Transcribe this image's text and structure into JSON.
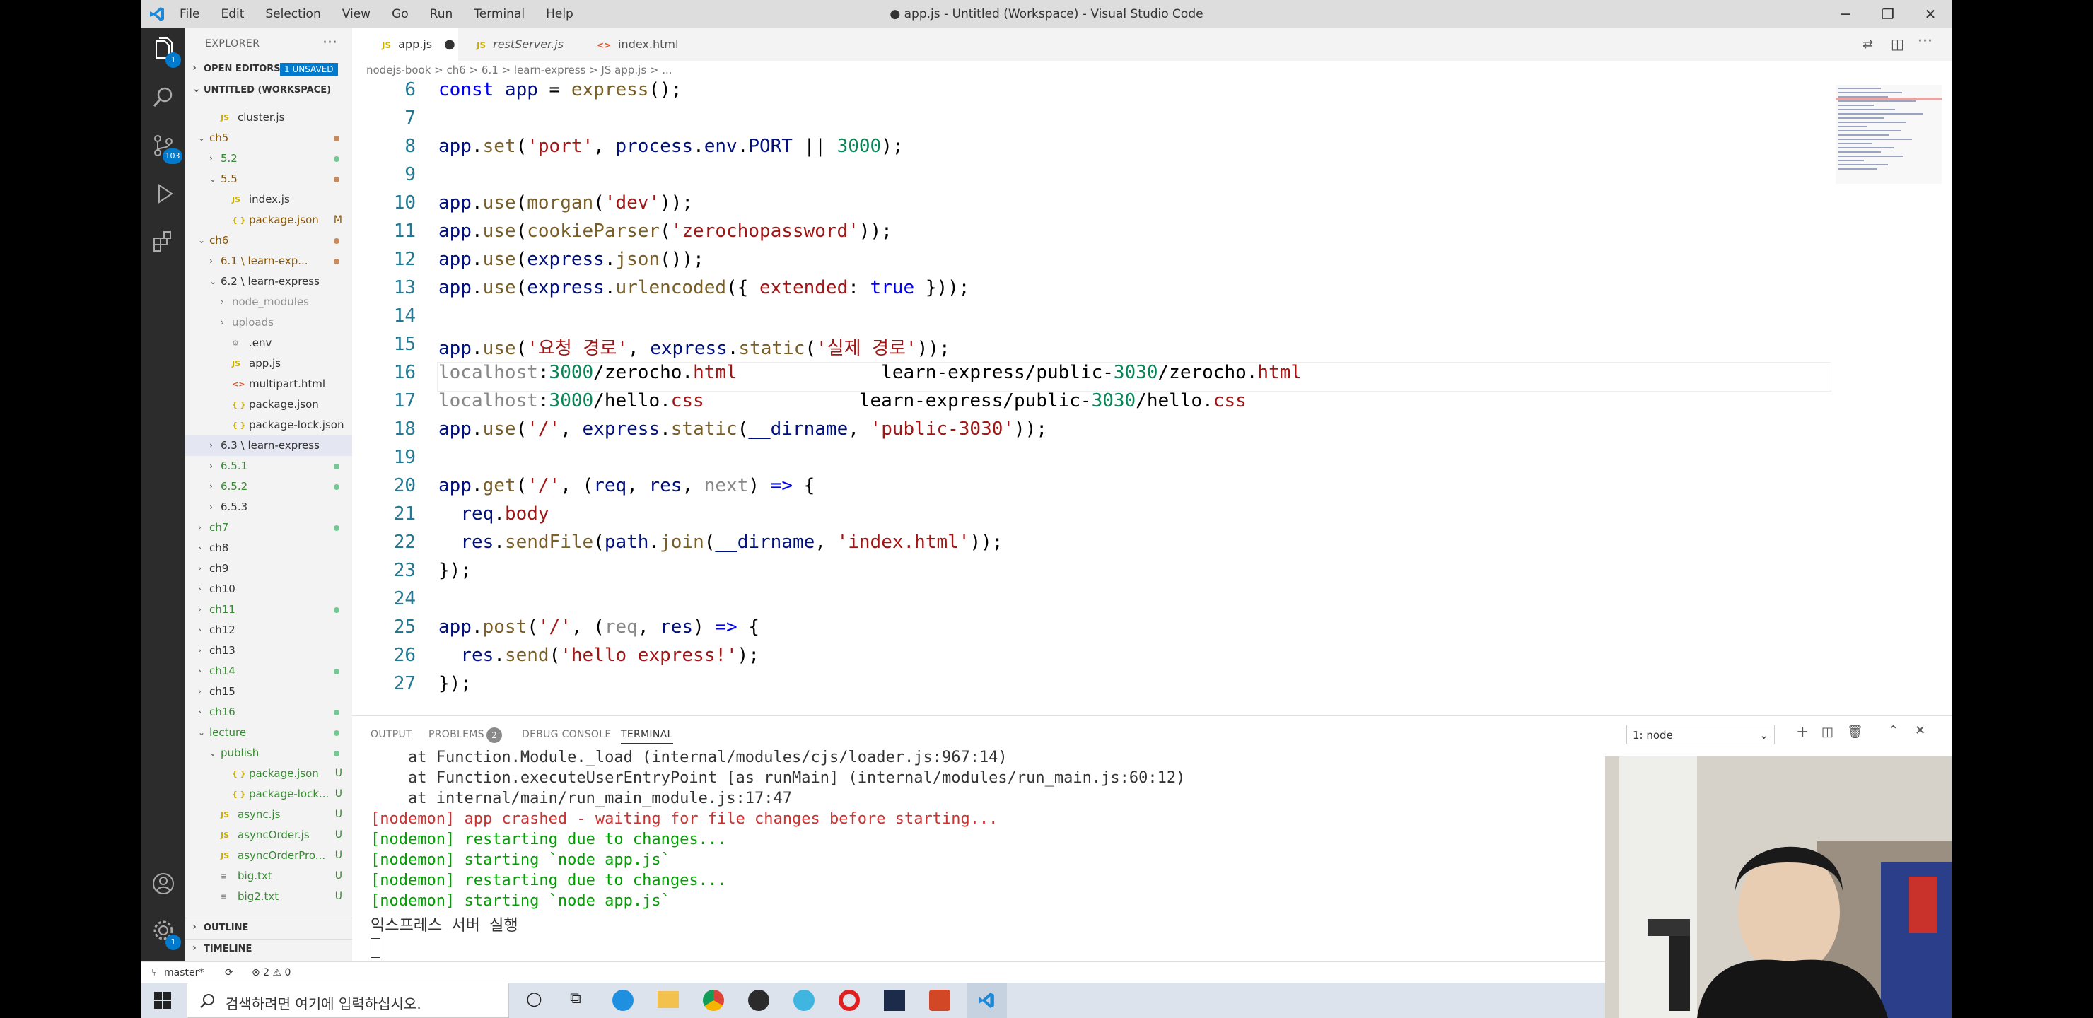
{
  "window": {
    "title": "● app.js - Untitled (Workspace) - Visual Studio Code",
    "menus": [
      "File",
      "Edit",
      "Selection",
      "View",
      "Go",
      "Run",
      "Terminal",
      "Help"
    ]
  },
  "activity": {
    "explorer_badge": "1",
    "scm_badge": "103",
    "settings_badge": "1"
  },
  "sidebar": {
    "header": "EXPLORER",
    "open_editors": "OPEN EDITORS",
    "unsaved_badge": "1 UNSAVED",
    "workspace": "UNTITLED (WORKSPACE)",
    "outline": "OUTLINE",
    "timeline": "TIMELINE",
    "tree": [
      {
        "name": "cluster.js",
        "type": "js",
        "indent": 1,
        "mark": ""
      },
      {
        "name": "ch5",
        "type": "folder",
        "open": true,
        "indent": 0,
        "mark": "dot-red"
      },
      {
        "name": "5.2",
        "type": "folder",
        "open": false,
        "indent": 1,
        "mark": "dot-green"
      },
      {
        "name": "5.5",
        "type": "folder",
        "open": true,
        "indent": 1,
        "mark": "dot-red"
      },
      {
        "name": "index.js",
        "type": "js",
        "indent": 2,
        "mark": ""
      },
      {
        "name": "package.json",
        "type": "json",
        "indent": 2,
        "mark": "M"
      },
      {
        "name": "ch6",
        "type": "folder",
        "open": true,
        "indent": 0,
        "mark": "dot-red"
      },
      {
        "name": "6.1 \\ learn-exp...",
        "type": "folder",
        "open": false,
        "indent": 1,
        "mark": "dot-red"
      },
      {
        "name": "6.2 \\ learn-express",
        "type": "folder",
        "open": true,
        "indent": 1,
        "mark": ""
      },
      {
        "name": "node_modules",
        "type": "folder",
        "open": false,
        "indent": 2,
        "mark": ""
      },
      {
        "name": "uploads",
        "type": "folder",
        "open": false,
        "indent": 2,
        "mark": ""
      },
      {
        "name": ".env",
        "type": "gear",
        "indent": 2,
        "mark": ""
      },
      {
        "name": "app.js",
        "type": "js",
        "indent": 2,
        "mark": ""
      },
      {
        "name": "multipart.html",
        "type": "html",
        "indent": 2,
        "mark": ""
      },
      {
        "name": "package.json",
        "type": "json",
        "indent": 2,
        "mark": ""
      },
      {
        "name": "package-lock.json",
        "type": "json",
        "indent": 2,
        "mark": ""
      },
      {
        "name": "6.3 \\ learn-express",
        "type": "folder",
        "open": false,
        "indent": 1,
        "mark": "",
        "selected": true
      },
      {
        "name": "6.5.1",
        "type": "folder",
        "open": false,
        "indent": 1,
        "mark": "dot-green"
      },
      {
        "name": "6.5.2",
        "type": "folder",
        "open": false,
        "indent": 1,
        "mark": "dot-green"
      },
      {
        "name": "6.5.3",
        "type": "folder",
        "open": false,
        "indent": 1,
        "mark": ""
      },
      {
        "name": "ch7",
        "type": "folder",
        "open": false,
        "indent": 0,
        "mark": "dot-green"
      },
      {
        "name": "ch8",
        "type": "folder",
        "open": false,
        "indent": 0,
        "mark": ""
      },
      {
        "name": "ch9",
        "type": "folder",
        "open": false,
        "indent": 0,
        "mark": ""
      },
      {
        "name": "ch10",
        "type": "folder",
        "open": false,
        "indent": 0,
        "mark": ""
      },
      {
        "name": "ch11",
        "type": "folder",
        "open": false,
        "indent": 0,
        "mark": "dot-green"
      },
      {
        "name": "ch12",
        "type": "folder",
        "open": false,
        "indent": 0,
        "mark": ""
      },
      {
        "name": "ch13",
        "type": "folder",
        "open": false,
        "indent": 0,
        "mark": ""
      },
      {
        "name": "ch14",
        "type": "folder",
        "open": false,
        "indent": 0,
        "mark": "dot-green"
      },
      {
        "name": "ch15",
        "type": "folder",
        "open": false,
        "indent": 0,
        "mark": ""
      },
      {
        "name": "ch16",
        "type": "folder",
        "open": false,
        "indent": 0,
        "mark": "dot-green"
      },
      {
        "name": "lecture",
        "type": "folder",
        "open": true,
        "indent": 0,
        "mark": "dot-green"
      },
      {
        "name": "publish",
        "type": "folder",
        "open": true,
        "indent": 1,
        "mark": "dot-green"
      },
      {
        "name": "package.json",
        "type": "json",
        "indent": 2,
        "mark": "U"
      },
      {
        "name": "package-lock...",
        "type": "json",
        "indent": 2,
        "mark": "U"
      },
      {
        "name": "async.js",
        "type": "js",
        "indent": 1,
        "mark": "U"
      },
      {
        "name": "asyncOrder.js",
        "type": "js",
        "indent": 1,
        "mark": "U"
      },
      {
        "name": "asyncOrderPro...",
        "type": "js",
        "indent": 1,
        "mark": "U"
      },
      {
        "name": "big.txt",
        "type": "txt",
        "indent": 1,
        "mark": "U"
      },
      {
        "name": "big2.txt",
        "type": "txt",
        "indent": 1,
        "mark": "U"
      }
    ]
  },
  "tabs": [
    {
      "label": "app.js",
      "icon": "JS",
      "active": true,
      "dirty": true
    },
    {
      "label": "restServer.js",
      "icon": "JS",
      "active": false,
      "dirty": false
    },
    {
      "label": "index.html",
      "icon": "<>",
      "active": false,
      "dirty": false
    }
  ],
  "breadcrumb": "nodejs-book  >  ch6  >  6.1  >  learn-express  >  JS app.js  >  ...",
  "editor": {
    "lines": [
      {
        "n": "6",
        "html": "<span class='k'>const</span> <span class='v'>app</span> = <span class='f'>express</span>();"
      },
      {
        "n": "7",
        "html": ""
      },
      {
        "n": "8",
        "html": "<span class='v'>app</span>.<span class='f'>set</span>(<span class='s'>'port'</span>, <span class='v'>process</span>.<span class='v'>env</span>.<span class='v'>PORT</span> || <span class='n'>3000</span>);"
      },
      {
        "n": "9",
        "html": ""
      },
      {
        "n": "10",
        "html": "<span class='v'>app</span>.<span class='f'>use</span>(<span class='f'>morgan</span>(<span class='s'>'dev'</span>));"
      },
      {
        "n": "11",
        "html": "<span class='v'>app</span>.<span class='f'>use</span>(<span class='f'>cookieParser</span>(<span class='s'>'zerochopassword'</span>));"
      },
      {
        "n": "12",
        "html": "<span class='v'>app</span>.<span class='f'>use</span>(<span class='v'>express</span>.<span class='f'>json</span>());"
      },
      {
        "n": "13",
        "html": "<span class='v'>app</span>.<span class='f'>use</span>(<span class='v'>express</span>.<span class='f'>urlencoded</span>({ <span class='s'>extended</span>: <span class='k'>true</span> }));"
      },
      {
        "n": "14",
        "html": ""
      },
      {
        "n": "15",
        "html": "<span class='v'>app</span>.<span class='f'>use</span>(<span class='s'>'요청 경로'</span>, <span class='v'>express</span>.<span class='f'>static</span>(<span class='s'>'실제 경로'</span>));"
      },
      {
        "n": "16",
        "html": "<span class='dim'>localhost</span>:<span class='n'>3000</span>/zerocho.<span class='s'>html</span>             learn-express/public-<span class='n'>3030</span>/zerocho.<span class='s'>html</span>"
      },
      {
        "n": "17",
        "html": "<span class='dim'>localhost</span>:<span class='n'>3000</span>/hello.<span class='s'>css</span>              learn-express/public-<span class='n'>3030</span>/hello.<span class='s'>css</span>"
      },
      {
        "n": "18",
        "html": "<span class='v'>app</span>.<span class='f'>use</span>(<span class='s'>'/'</span>, <span class='v'>express</span>.<span class='f'>static</span>(<span class='v'>__dirname</span>, <span class='s'>'public-3030'</span>));"
      },
      {
        "n": "19",
        "html": ""
      },
      {
        "n": "20",
        "html": "<span class='v'>app</span>.<span class='f'>get</span>(<span class='s'>'/'</span>, (<span class='v'>req</span>, <span class='v'>res</span>, <span class='dim'>next</span>) <span class='k'>=&gt;</span> {"
      },
      {
        "n": "21",
        "html": "  <span class='v'>req</span>.<span class='s'>body</span>"
      },
      {
        "n": "22",
        "html": "  <span class='v'>res</span>.<span class='f'>sendFile</span>(<span class='v'>path</span>.<span class='f'>join</span>(<span class='v'>__dirname</span>, <span class='s'>'index.html'</span>));"
      },
      {
        "n": "23",
        "html": "});"
      },
      {
        "n": "24",
        "html": ""
      },
      {
        "n": "25",
        "html": "<span class='v'>app</span>.<span class='f'>post</span>(<span class='s'>'/'</span>, (<span class='dim'>req</span>, <span class='v'>res</span>) <span class='k'>=&gt;</span> {"
      },
      {
        "n": "26",
        "html": "  <span class='v'>res</span>.<span class='f'>send</span>(<span class='s'>'hello express!'</span>);"
      },
      {
        "n": "27",
        "html": "});"
      }
    ]
  },
  "panel": {
    "tabs": [
      {
        "label": "OUTPUT",
        "active": false
      },
      {
        "label": "PROBLEMS",
        "active": false,
        "badge": "2"
      },
      {
        "label": "DEBUG CONSOLE",
        "active": false
      },
      {
        "label": "TERMINAL",
        "active": true
      }
    ],
    "terminal_select": "1: node",
    "terminal_lines": [
      {
        "text": "    at Function.Module._load (internal/modules/cjs/loader.js:967:14)",
        "color": "#333333"
      },
      {
        "text": "    at Function.executeUserEntryPoint [as runMain] (internal/modules/run_main.js:60:12)",
        "color": "#333333"
      },
      {
        "text": "    at internal/main/run_main_module.js:17:47",
        "color": "#333333"
      },
      {
        "text": "[nodemon] app crashed - waiting for file changes before starting...",
        "color": "#cd3131"
      },
      {
        "text": "[nodemon] restarting due to changes...",
        "color": "#00a000"
      },
      {
        "text": "[nodemon] starting `node app.js`",
        "color": "#00a000"
      },
      {
        "text": "[nodemon] restarting due to changes...",
        "color": "#00a000"
      },
      {
        "text": "[nodemon] starting `node app.js`",
        "color": "#00a000"
      },
      {
        "text": "익스프레스 서버 실행",
        "color": "#333333"
      }
    ]
  },
  "statusbar": {
    "branch": "master*",
    "problems": "⊗ 2 ⚠ 0"
  },
  "taskbar": {
    "search_placeholder": "검색하려면 여기에 입력하십시오."
  }
}
